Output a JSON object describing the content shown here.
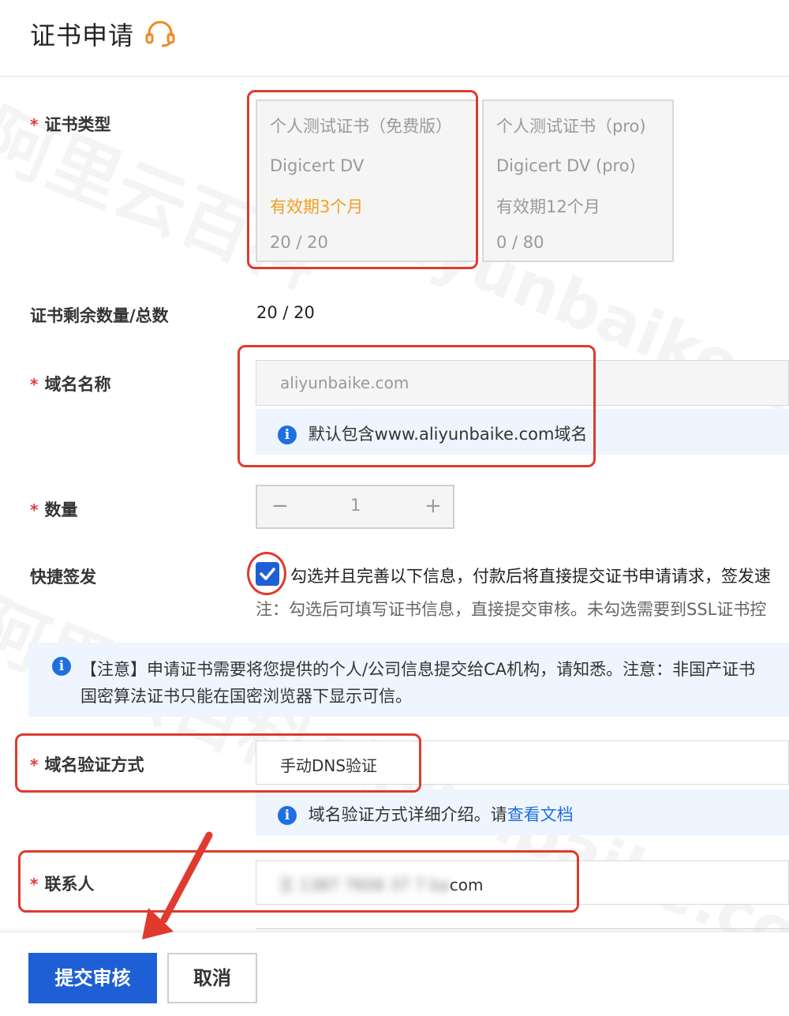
{
  "page": {
    "title": "证书申请",
    "support_icon": "headset-icon"
  },
  "fields": {
    "cert_type_label": "证书类型",
    "remain_label": "证书剩余数量/总数",
    "remain_value": "20 / 20",
    "domain_label": "域名名称",
    "quantity_label": "数量",
    "quick_issue_label": "快捷签发",
    "verify_label": "域名验证方式",
    "contact_label": "联系人"
  },
  "cert_options": [
    {
      "name": "个人测试证书（免费版）",
      "brand": "Digicert DV",
      "validity": "有效期3个月",
      "usage": "20 / 20"
    },
    {
      "name": "个人测试证书（pro)",
      "brand": "Digicert DV (pro)",
      "validity": "有效期12个月",
      "usage": "0 / 80"
    }
  ],
  "domain": {
    "placeholder": "aliyunbaike.com",
    "hint": "默认包含www.aliyunbaike.com域名"
  },
  "quantity": {
    "minus": "−",
    "value": "1",
    "plus": "+"
  },
  "quick_issue": {
    "checked": true,
    "text": "勾选并且完善以下信息，付款后将直接提交证书申请请求，签发速",
    "note": "注：勾选后可填写证书信息，直接提交审核。未勾选需要到SSL证书控"
  },
  "notice": {
    "line1": "【注意】申请证书需要将您提供的个人/公司信息提交给CA机构，请知悉。注意：非国产证书",
    "line2": "国密算法证书只能在国密浏览器下显示可信。"
  },
  "verify": {
    "value": "手动DNS验证",
    "hint_prefix": "域名验证方式详细介绍。请",
    "hint_link": "查看文档"
  },
  "contact": {
    "blurred": "王 1387 7656 37 7 ba",
    "suffix": "com"
  },
  "buttons": {
    "submit": "提交审核",
    "cancel": "取消"
  },
  "watermark": {
    "cn": "阿里云百科",
    "en": "aliyunbaike.com"
  },
  "colors": {
    "primary": "#1f5fd6",
    "highlight": "#e03a2e",
    "required": "#e4393c",
    "validity": "#f0a020",
    "info_bg": "#eef5ff"
  }
}
